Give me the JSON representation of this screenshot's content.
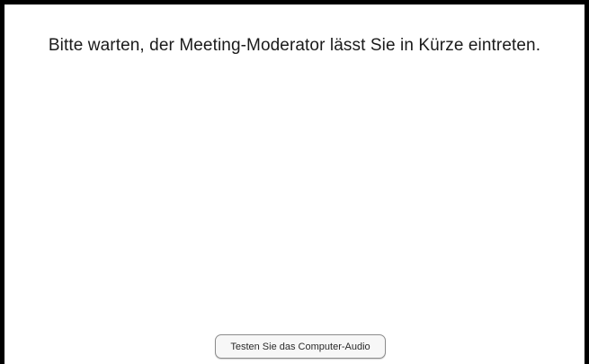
{
  "waiting_room": {
    "message": "Bitte warten, der Meeting-Moderator lässt Sie in Kürze eintreten.",
    "test_audio_label": "Testen Sie das Computer-Audio"
  }
}
